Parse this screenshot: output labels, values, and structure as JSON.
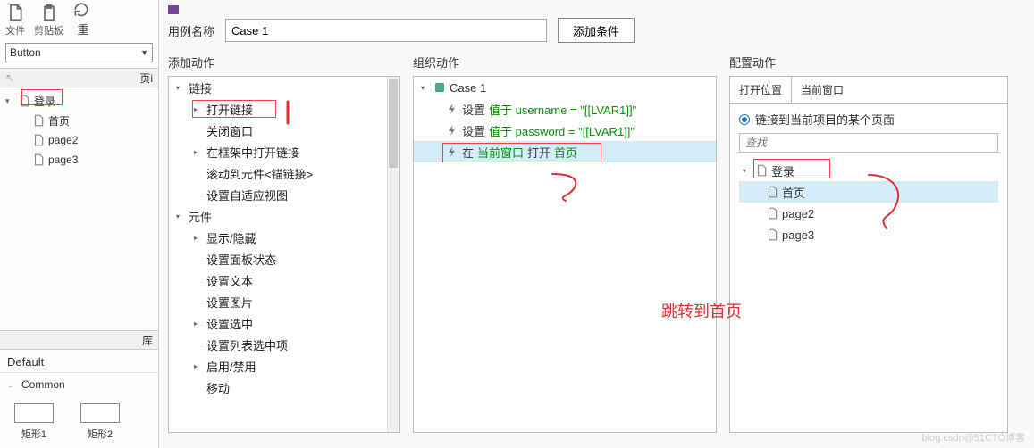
{
  "left": {
    "file_label": "文件",
    "clipboard_label": "剪贴板",
    "reload_trunc": "重",
    "dropdown_value": "Button",
    "pages_tab": "页面",
    "pages_short": "页i",
    "tree": {
      "root": "登录",
      "children": [
        "首页",
        "page2",
        "page3"
      ]
    },
    "lib_label": "库",
    "default_label": "Default",
    "common_label": "Common",
    "shapes": [
      "矩形1",
      "矩形2"
    ]
  },
  "dialog": {
    "case_label": "用例名称",
    "case_value": "Case 1",
    "add_cond_btn": "添加条件",
    "add_actions_title": "添加动作",
    "org_actions_title": "组织动作",
    "cfg_actions_title": "配置动作",
    "add_tree": {
      "g_link": "链接",
      "open_link": "打开链接",
      "close_window": "关闭窗口",
      "open_in_frame": "在框架中打开链接",
      "scroll_to": "滚动到元件<锚链接>",
      "adaptive": "设置自适应视图",
      "g_comp": "元件",
      "show_hide": "显示/隐藏",
      "panel_state": "设置面板状态",
      "set_text": "设置文本",
      "set_img": "设置图片",
      "g_sel": "设置选中",
      "set_list_sel": "设置列表选中项",
      "g_enable": "启用/禁用",
      "move": "移动"
    },
    "org": {
      "case": "Case 1",
      "a1_pre": "设置",
      "a1_val": "值于 username = \"[[LVAR1]]\"",
      "a2_pre": "设置",
      "a2_val": "值于 password = \"[[LVAR1]]\"",
      "a3_pre": "在",
      "a3_mid": "当前窗口",
      "a3_mid2": "打开",
      "a3_tgt": "首页"
    },
    "cfg": {
      "open_loc_label": "打开位置",
      "open_loc_value": "当前窗口",
      "radio_label": "链接到当前项目的某个页面",
      "search_ph": "查找",
      "tree_root": "登录",
      "tree_children": [
        "首页",
        "page2",
        "page3"
      ]
    }
  },
  "annot": {
    "jump": "跳转到首页"
  },
  "watermark": "blog.csdn@51CTO博客"
}
